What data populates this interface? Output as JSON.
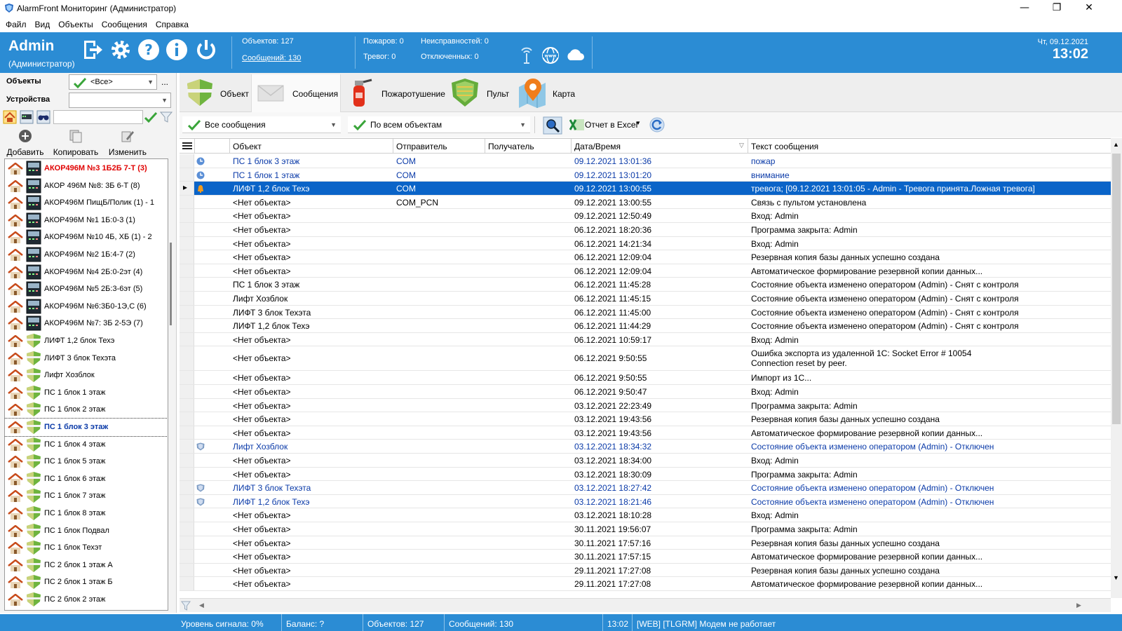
{
  "window": {
    "title": "AlarmFront Мониторинг (Администратор)",
    "minimize": "—",
    "maximize": "❐",
    "close": "✕"
  },
  "menu": [
    "Файл",
    "Вид",
    "Объекты",
    "Сообщения",
    "Справка"
  ],
  "header": {
    "user": "Admin",
    "role": "(Администратор)",
    "objects_label": "Объектов: 127",
    "messages_label": "Сообщений: 130",
    "fires": "Пожаров: 0",
    "alarms": "Тревог: 0",
    "faults": "Неисправностей: 0",
    "disabled": "Отключенных: 0",
    "date": "Чт, 09.12.2021",
    "time": "13:02"
  },
  "left": {
    "objects_label": "Объекты",
    "objects_value": "<Все>",
    "more": "...",
    "devices_label": "Устройства",
    "devices_value": "",
    "actions": [
      "Добавить",
      "Копировать",
      "Изменить"
    ],
    "tree": [
      {
        "label": "АКОР496М №3 1Б2Б 7-Т (3)",
        "type": "device",
        "style": "red"
      },
      {
        "label": "АКОР 496М №8: 3Б 6-Т (8)",
        "type": "device",
        "style": ""
      },
      {
        "label": "АКОР496М ПищБ/Полик (1) - 1",
        "type": "device",
        "style": ""
      },
      {
        "label": "АКОР496М №1 1Б:0-3 (1)",
        "type": "device",
        "style": ""
      },
      {
        "label": "АКОР496М №10 4Б, ХБ (1) - 2",
        "type": "device",
        "style": ""
      },
      {
        "label": "АКОР496М №2 1Б:4-7 (2)",
        "type": "device",
        "style": ""
      },
      {
        "label": "АКОР496М №4 2Б:0-2эт (4)",
        "type": "device",
        "style": ""
      },
      {
        "label": "АКОР496М №5 2Б:3-6эт (5)",
        "type": "device",
        "style": ""
      },
      {
        "label": "АКОР496М №6:3Б0-1Э,С (6)",
        "type": "device",
        "style": ""
      },
      {
        "label": "АКОР496М №7: 3Б 2-5Э (7)",
        "type": "device",
        "style": ""
      },
      {
        "label": "ЛИФТ 1,2 блок Техэ",
        "type": "shield",
        "style": ""
      },
      {
        "label": "ЛИФТ 3 блок Техэта",
        "type": "shield",
        "style": ""
      },
      {
        "label": "Лифт Хозблок",
        "type": "shield",
        "style": ""
      },
      {
        "label": "ПС 1 блок 1 этаж",
        "type": "shield",
        "style": ""
      },
      {
        "label": "ПС 1 блок 2 этаж",
        "type": "shield",
        "style": ""
      },
      {
        "label": "ПС 1 блок 3 этаж",
        "type": "shield",
        "style": "focus"
      },
      {
        "label": "ПС 1 блок 4 этаж",
        "type": "shield",
        "style": ""
      },
      {
        "label": "ПС 1 блок 5 этаж",
        "type": "shield",
        "style": ""
      },
      {
        "label": "ПС 1 блок 6 этаж",
        "type": "shield",
        "style": ""
      },
      {
        "label": "ПС 1 блок 7 этаж",
        "type": "shield",
        "style": ""
      },
      {
        "label": "ПС 1 блок 8 этаж",
        "type": "shield",
        "style": ""
      },
      {
        "label": "ПС 1 блок Подвал",
        "type": "shield",
        "style": ""
      },
      {
        "label": "ПС 1 блок Техэт",
        "type": "shield",
        "style": ""
      },
      {
        "label": "ПС 2 блок 1 этаж А",
        "type": "shield",
        "style": ""
      },
      {
        "label": "ПС 2 блок 1 этаж Б",
        "type": "shield",
        "style": ""
      },
      {
        "label": "ПС 2 блок 2 этаж",
        "type": "shield",
        "style": "clip"
      }
    ]
  },
  "toolbar": {
    "tabs": [
      "Объект",
      "Сообщения",
      "Пожаротушение",
      "Пульт",
      "Карта"
    ]
  },
  "filters": {
    "messages": "Все сообщения",
    "objects": "По всем объектам",
    "excel": "Отчет в Excel"
  },
  "grid": {
    "columns": [
      "Объект",
      "Отправитель",
      "Получатель",
      "Дата/Время",
      "Текст сообщения"
    ],
    "rows": [
      {
        "obj": "ПС 1 блок 3 этаж",
        "from": "COM",
        "to": "",
        "dt": "09.12.2021 13:01:36",
        "text": "пожар",
        "text2": "",
        "icon": "clock",
        "style": "blue"
      },
      {
        "obj": "ПС 1 блок 1 этаж",
        "from": "COM",
        "to": "",
        "dt": "09.12.2021 13:01:20",
        "text": "внимание",
        "text2": "",
        "icon": "clock",
        "style": "blue"
      },
      {
        "obj": "ЛИФТ 1,2 блок Техэ",
        "from": "COM",
        "to": "",
        "dt": "09.12.2021 13:00:55",
        "text": "тревога;  [09.12.2021 13:01:05 - Admin - Тревога принята.Ложная тревога]",
        "text2": "",
        "icon": "bell",
        "style": "sel"
      },
      {
        "obj": "<Нет объекта>",
        "from": "COM_PCN",
        "to": "",
        "dt": "09.12.2021 13:00:55",
        "text": "Связь с пультом установлена",
        "text2": "",
        "icon": "",
        "style": ""
      },
      {
        "obj": "<Нет объекта>",
        "from": "",
        "to": "",
        "dt": "09.12.2021 12:50:49",
        "text": "Вход: Admin",
        "text2": "",
        "icon": "",
        "style": ""
      },
      {
        "obj": "<Нет объекта>",
        "from": "",
        "to": "",
        "dt": "06.12.2021 18:20:36",
        "text": "Программа закрыта: Admin",
        "text2": "",
        "icon": "",
        "style": ""
      },
      {
        "obj": "<Нет объекта>",
        "from": "",
        "to": "",
        "dt": "06.12.2021 14:21:34",
        "text": "Вход: Admin",
        "text2": "",
        "icon": "",
        "style": ""
      },
      {
        "obj": "<Нет объекта>",
        "from": "",
        "to": "",
        "dt": "06.12.2021 12:09:04",
        "text": "Резервная копия базы данных успешно создана",
        "text2": "",
        "icon": "",
        "style": ""
      },
      {
        "obj": "<Нет объекта>",
        "from": "",
        "to": "",
        "dt": "06.12.2021 12:09:04",
        "text": "Автоматическое формирование резервной копии данных...",
        "text2": "",
        "icon": "",
        "style": ""
      },
      {
        "obj": "ПС 1 блок 3 этаж",
        "from": "",
        "to": "",
        "dt": "06.12.2021 11:45:28",
        "text": "Состояние объекта изменено оператором (Admin) - Снят с контроля",
        "text2": "",
        "icon": "",
        "style": ""
      },
      {
        "obj": "Лифт Хозблок",
        "from": "",
        "to": "",
        "dt": "06.12.2021 11:45:15",
        "text": "Состояние объекта изменено оператором (Admin) - Снят с контроля",
        "text2": "",
        "icon": "",
        "style": ""
      },
      {
        "obj": "ЛИФТ 3 блок Техэта",
        "from": "",
        "to": "",
        "dt": "06.12.2021 11:45:00",
        "text": "Состояние объекта изменено оператором (Admin) - Снят с контроля",
        "text2": "",
        "icon": "",
        "style": ""
      },
      {
        "obj": "ЛИФТ 1,2 блок Техэ",
        "from": "",
        "to": "",
        "dt": "06.12.2021 11:44:29",
        "text": "Состояние объекта изменено оператором (Admin) - Снят с контроля",
        "text2": "",
        "icon": "",
        "style": ""
      },
      {
        "obj": "<Нет объекта>",
        "from": "",
        "to": "",
        "dt": "06.12.2021 10:59:17",
        "text": "Вход: Admin",
        "text2": "",
        "icon": "",
        "style": ""
      },
      {
        "obj": "<Нет объекта>",
        "from": "",
        "to": "",
        "dt": "06.12.2021 9:50:55",
        "text": "Ошибка экспорта из удаленной 1С: Socket Error # 10054",
        "text2": "Connection reset by peer.",
        "icon": "",
        "style": ""
      },
      {
        "obj": "<Нет объекта>",
        "from": "",
        "to": "",
        "dt": "06.12.2021 9:50:55",
        "text": "Импорт из 1С...",
        "text2": "",
        "icon": "",
        "style": ""
      },
      {
        "obj": "<Нет объекта>",
        "from": "",
        "to": "",
        "dt": "06.12.2021 9:50:47",
        "text": "Вход: Admin",
        "text2": "",
        "icon": "",
        "style": ""
      },
      {
        "obj": "<Нет объекта>",
        "from": "",
        "to": "",
        "dt": "03.12.2021 22:23:49",
        "text": "Программа закрыта: Admin",
        "text2": "",
        "icon": "",
        "style": ""
      },
      {
        "obj": "<Нет объекта>",
        "from": "",
        "to": "",
        "dt": "03.12.2021 19:43:56",
        "text": "Резервная копия базы данных успешно создана",
        "text2": "",
        "icon": "",
        "style": ""
      },
      {
        "obj": "<Нет объекта>",
        "from": "",
        "to": "",
        "dt": "03.12.2021 19:43:56",
        "text": "Автоматическое формирование резервной копии данных...",
        "text2": "",
        "icon": "",
        "style": ""
      },
      {
        "obj": "Лифт Хозблок",
        "from": "",
        "to": "",
        "dt": "03.12.2021 18:34:32",
        "text": "Состояние объекта изменено оператором (Admin) - Отключен",
        "text2": "",
        "icon": "shield",
        "style": "blue"
      },
      {
        "obj": "<Нет объекта>",
        "from": "",
        "to": "",
        "dt": "03.12.2021 18:34:00",
        "text": "Вход: Admin",
        "text2": "",
        "icon": "",
        "style": ""
      },
      {
        "obj": "<Нет объекта>",
        "from": "",
        "to": "",
        "dt": "03.12.2021 18:30:09",
        "text": "Программа закрыта: Admin",
        "text2": "",
        "icon": "",
        "style": ""
      },
      {
        "obj": "ЛИФТ 3 блок Техэта",
        "from": "",
        "to": "",
        "dt": "03.12.2021 18:27:42",
        "text": "Состояние объекта изменено оператором (Admin) - Отключен",
        "text2": "",
        "icon": "shield",
        "style": "blue"
      },
      {
        "obj": "ЛИФТ 1,2 блок Техэ",
        "from": "",
        "to": "",
        "dt": "03.12.2021 18:21:46",
        "text": "Состояние объекта изменено оператором (Admin) - Отключен",
        "text2": "",
        "icon": "shield",
        "style": "blue"
      },
      {
        "obj": "<Нет объекта>",
        "from": "",
        "to": "",
        "dt": "03.12.2021 18:10:28",
        "text": "Вход: Admin",
        "text2": "",
        "icon": "",
        "style": ""
      },
      {
        "obj": "<Нет объекта>",
        "from": "",
        "to": "",
        "dt": "30.11.2021 19:56:07",
        "text": "Программа закрыта: Admin",
        "text2": "",
        "icon": "",
        "style": ""
      },
      {
        "obj": "<Нет объекта>",
        "from": "",
        "to": "",
        "dt": "30.11.2021 17:57:16",
        "text": "Резервная копия базы данных успешно создана",
        "text2": "",
        "icon": "",
        "style": ""
      },
      {
        "obj": "<Нет объекта>",
        "from": "",
        "to": "",
        "dt": "30.11.2021 17:57:15",
        "text": "Автоматическое формирование резервной копии данных...",
        "text2": "",
        "icon": "",
        "style": ""
      },
      {
        "obj": "<Нет объекта>",
        "from": "",
        "to": "",
        "dt": "29.11.2021 17:27:08",
        "text": "Резервная копия базы данных успешно создана",
        "text2": "",
        "icon": "",
        "style": ""
      },
      {
        "obj": "<Нет объекта>",
        "from": "",
        "to": "",
        "dt": "29.11.2021 17:27:08",
        "text": "Автоматическое формирование резервной копии данных...",
        "text2": "",
        "icon": "",
        "style": ""
      }
    ]
  },
  "status": {
    "signal": "Уровень сигнала: 0%",
    "balance": "Баланс: ?",
    "objects": "Объектов: 127",
    "messages": "Сообщений: 130",
    "time": "13:02",
    "web": "[WEB] [TLGRM] Модем не работает"
  },
  "colors": {
    "header_bg": "#2b8cd4",
    "selection": "#0a64c8",
    "link_blue": "#0a3aa8",
    "alert_red": "#e00000"
  }
}
